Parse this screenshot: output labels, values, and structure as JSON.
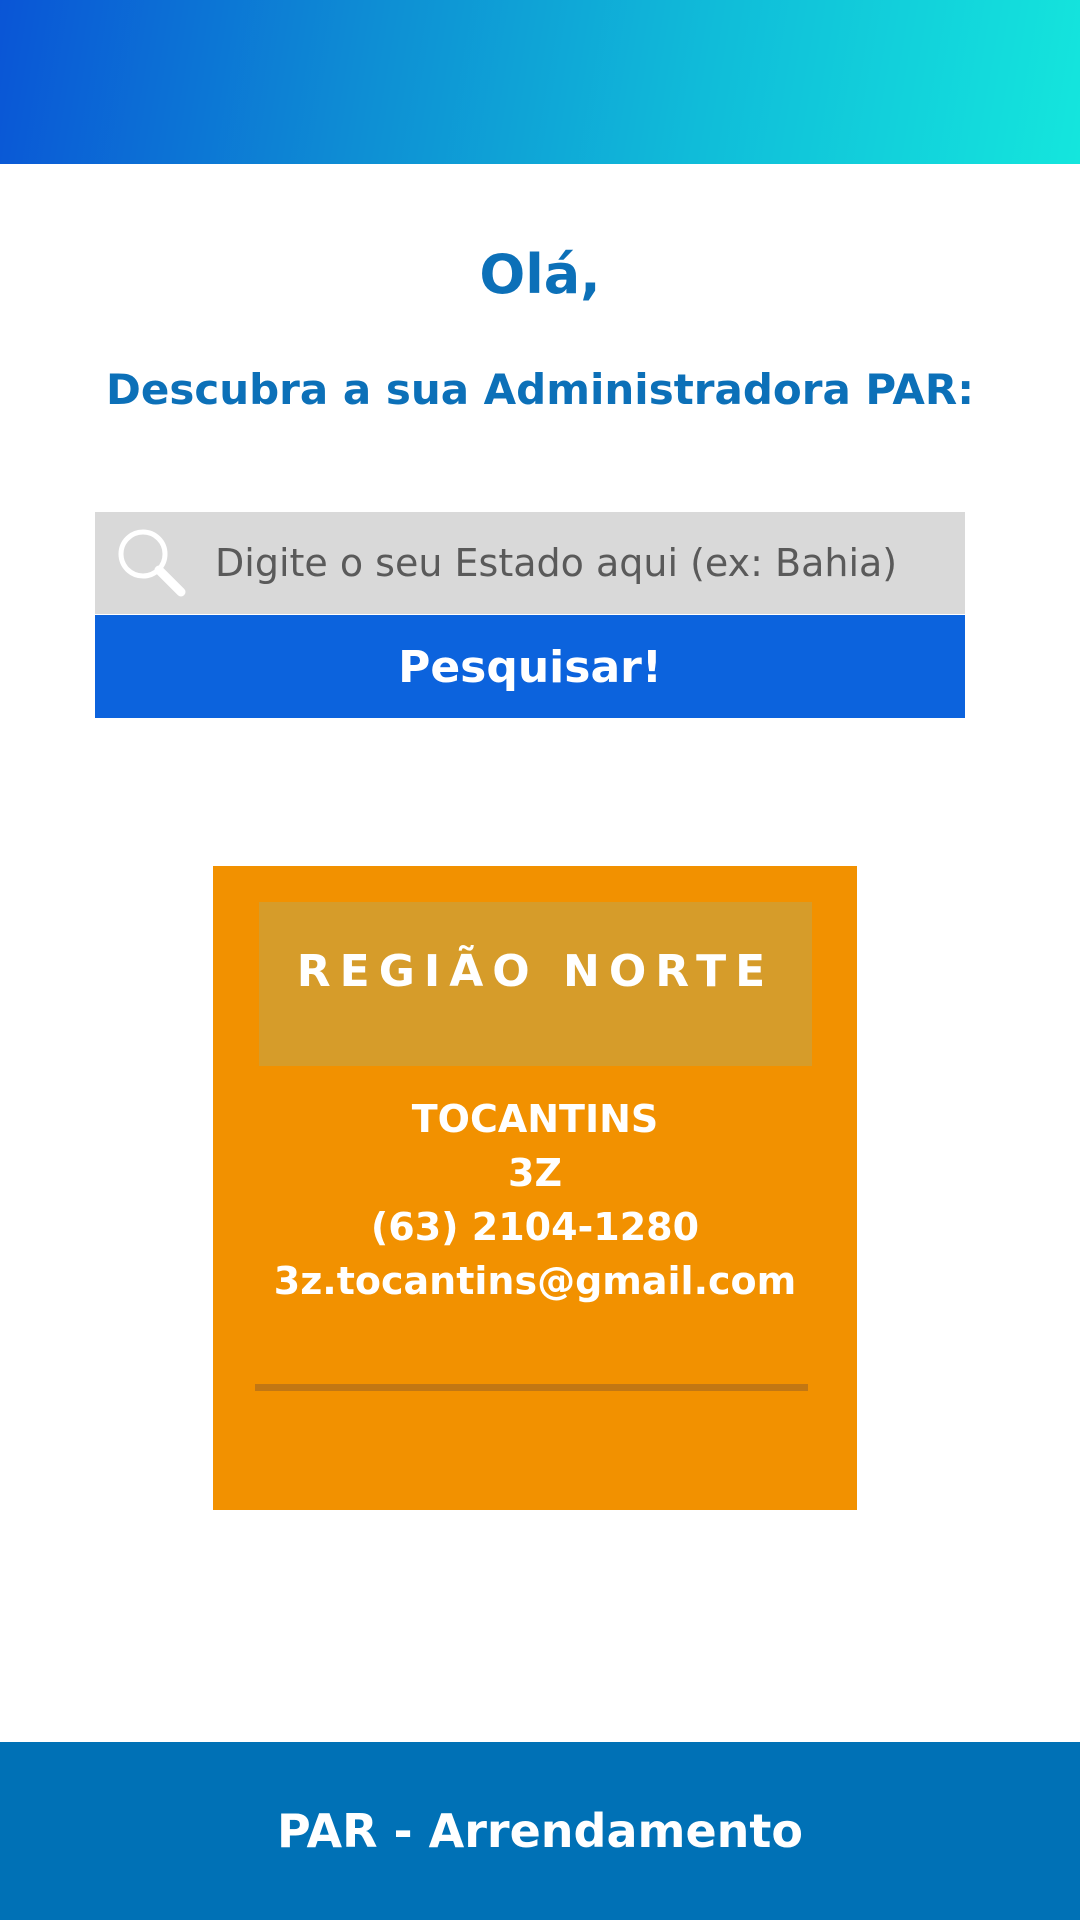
{
  "header": {
    "greeting": "Olá,",
    "subtitle": "Descubra a sua Administradora PAR:"
  },
  "search": {
    "placeholder": "Digite o seu Estado aqui (ex: Bahia)",
    "value": "",
    "icon": "search-icon",
    "button_label": "Pesquisar!"
  },
  "region": {
    "title": "REGIÃO NORTE",
    "state": "TOCANTINS",
    "administrator": "3Z",
    "phone": "(63) 2104-1280",
    "email": "3z.tocantins@gmail.com"
  },
  "footer": {
    "text": "PAR - Arrendamento"
  },
  "colors": {
    "banner_start": "#0a55d6",
    "banner_end": "#14e6dd",
    "heading_blue": "#0c70b8",
    "search_button": "#0c63dd",
    "card_orange": "#f29100",
    "card_header": "#d69c2a",
    "footer_blue": "#0071b6"
  }
}
